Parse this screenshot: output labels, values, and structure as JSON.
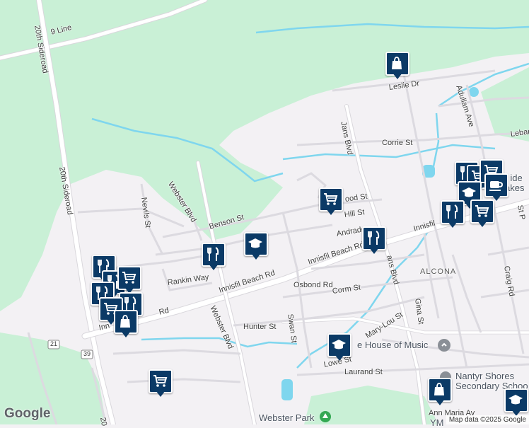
{
  "map": {
    "colors": {
      "land": "#f3f1f4",
      "park": "#c9f0d6",
      "road": "#ffffff",
      "road_edge": "#d9d7dc",
      "water": "#7fd6ee",
      "pin": "#0b3a66",
      "poi_gray": "#8a8f96",
      "poi_green": "#34a853"
    },
    "road_labels": [
      {
        "text": "9 Line"
      },
      {
        "text": "20th Sideroad"
      },
      {
        "text": "20th Sideroad"
      },
      {
        "text": "Leslie Dr"
      },
      {
        "text": "Adullam Ave"
      },
      {
        "text": "Lebar"
      },
      {
        "text": "Jans Blvd"
      },
      {
        "text": "Corrie St"
      },
      {
        "text": "Webster Blvd"
      },
      {
        "text": "Nevils St"
      },
      {
        "text": "Benson St"
      },
      {
        "text": "ood St"
      },
      {
        "text": "Hill St"
      },
      {
        "text": "Andrade"
      },
      {
        "text": "Innisfil Beach Rd"
      },
      {
        "text": "Innisfil Beach Rd"
      },
      {
        "text": "Innisfil"
      },
      {
        "text": "Rankin Way"
      },
      {
        "text": "Osbond Rd"
      },
      {
        "text": "Swan St"
      },
      {
        "text": "Corm St"
      },
      {
        "text": "Hunter St"
      },
      {
        "text": "Webster Blvd"
      },
      {
        "text": "Mary-Lou St"
      },
      {
        "text": "Gina St"
      },
      {
        "text": "Craig Rd"
      },
      {
        "text": "Lowe St"
      },
      {
        "text": "Laurand St"
      },
      {
        "text": "Ann Maria Av"
      },
      {
        "text": "ans Blvd"
      },
      {
        "text": "St P"
      },
      {
        "text": "Rd"
      },
      {
        "text": "Inn"
      },
      {
        "text": "20"
      }
    ],
    "area_label": "ALCONA",
    "poi_labels": [
      {
        "text": "e House of Music"
      },
      {
        "text": "Nantyr Shores"
      },
      {
        "text": "Secondary Schoo"
      },
      {
        "text": "Webster Park"
      },
      {
        "text": "il ide"
      },
      {
        "text": "akes"
      },
      {
        "text": "YM"
      }
    ],
    "shields": [
      {
        "text": "21"
      },
      {
        "text": "39"
      }
    ],
    "pins": [
      {
        "icon": "shopping-bag-icon"
      },
      {
        "icon": "shopping-cart-icon"
      },
      {
        "icon": "graduation-cap-icon"
      },
      {
        "icon": "restaurant-icon"
      },
      {
        "icon": "restaurant-icon"
      },
      {
        "icon": "restaurant-icon"
      },
      {
        "icon": "shopping-cart-icon"
      },
      {
        "icon": "shopping-cart-icon"
      },
      {
        "icon": "coffee-cup-icon"
      },
      {
        "icon": "graduation-cap-icon"
      },
      {
        "icon": "restaurant-icon"
      },
      {
        "icon": "restaurant-icon"
      },
      {
        "icon": "restaurant-icon"
      },
      {
        "icon": "shopping-cart-icon"
      },
      {
        "icon": "restaurant-icon"
      },
      {
        "icon": "restaurant-icon"
      },
      {
        "icon": "shopping-cart-icon"
      },
      {
        "icon": "shopping-bag-icon"
      },
      {
        "icon": "graduation-cap-icon"
      },
      {
        "icon": "shopping-cart-icon"
      }
    ],
    "logo": "Google",
    "attribution": "Map data ©2025 Google"
  }
}
